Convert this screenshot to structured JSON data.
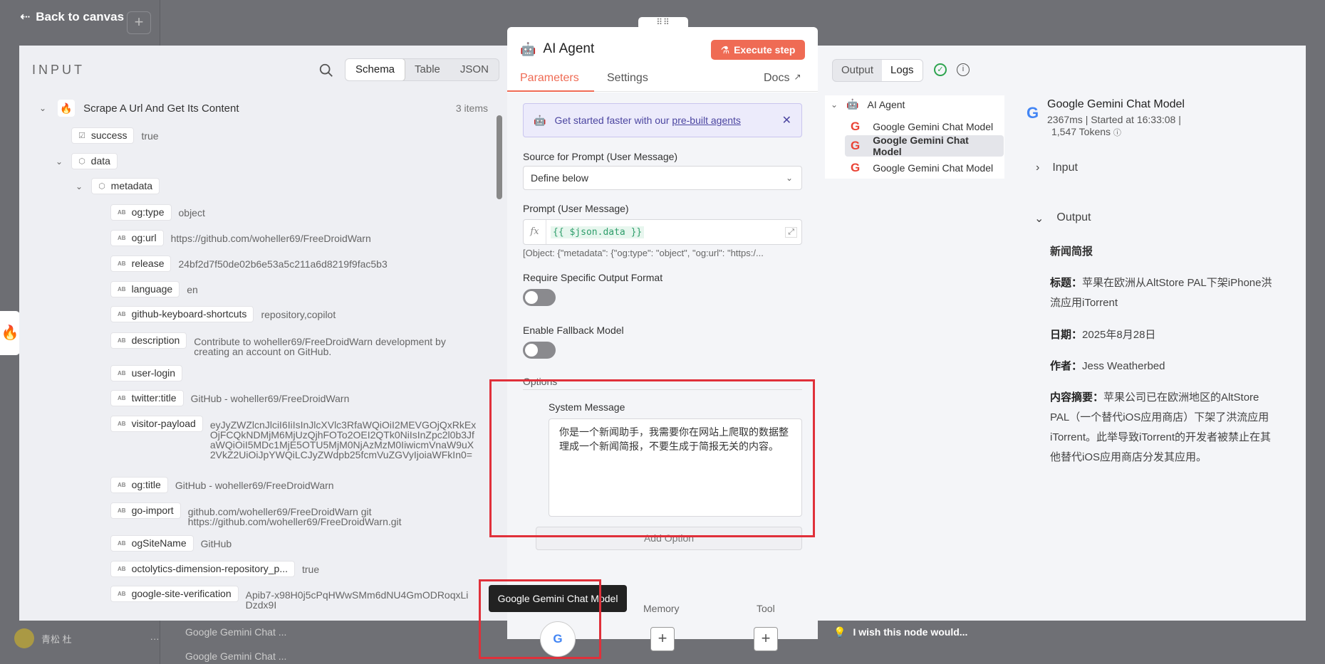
{
  "canvas": {
    "back_label": "Back to canvas",
    "user_name": "青松 杜",
    "bg_item1": "Google Gemini Chat ...",
    "bg_item2": "Google Gemini Chat ..."
  },
  "input": {
    "header": "INPUT",
    "tabs": [
      "Schema",
      "Table",
      "JSON"
    ],
    "active_tab": "Schema",
    "node_name": "Scrape A Url And Get Its Content",
    "items_count": "3 items",
    "fields": [
      {
        "key": "success",
        "value": "true"
      },
      {
        "key": "data",
        "value": ""
      },
      {
        "key": "metadata",
        "value": ""
      },
      {
        "key": "og:type",
        "value": "object"
      },
      {
        "key": "og:url",
        "value": "https://github.com/woheller69/FreeDroidWarn"
      },
      {
        "key": "release",
        "value": "24bf2d7f50de02b6e53a5c211a6d8219f9fac5b3"
      },
      {
        "key": "language",
        "value": "en"
      },
      {
        "key": "github-keyboard-shortcuts",
        "value": "repository,copilot"
      },
      {
        "key": "description",
        "value": "Contribute to woheller69/FreeDroidWarn development by creating an account on GitHub."
      },
      {
        "key": "user-login",
        "value": ""
      },
      {
        "key": "twitter:title",
        "value": "GitHub - woheller69/FreeDroidWarn"
      },
      {
        "key": "visitor-payload",
        "value": "eyJyZWZlcnJlciI6IiIsInJlcXVlc3RfaWQiOiI2MEVGOjQxRkExOjFCQkNDMjM6MjUzQjhFOTo2OEI2QTk0NiIsInZpc2l0b3JfaWQiOiI5MDc1MjE5OTU5MjM0NjAzMzM0IiwicmVnaW9uX2VkZ2UiOiJpYWQiLCJyZWdpb25fcmVuZGVyIjoiaWFkIn0="
      },
      {
        "key": "og:title",
        "value": "GitHub - woheller69/FreeDroidWarn"
      },
      {
        "key": "go-import",
        "value": "github.com/woheller69/FreeDroidWarn git https://github.com/woheller69/FreeDroidWarn.git"
      },
      {
        "key": "ogSiteName",
        "value": "GitHub"
      },
      {
        "key": "octolytics-dimension-repository_p...",
        "value": "true"
      },
      {
        "key": "google-site-verification",
        "value": "Apib7-x98H0j5cPqHWwSMm6dNU4GmODRoqxLiDzdx9I"
      }
    ]
  },
  "node": {
    "title": "AI Agent",
    "execute_label": "Execute step",
    "tabs": {
      "parameters": "Parameters",
      "settings": "Settings",
      "docs": "Docs"
    },
    "banner_prefix": "Get started faster with our ",
    "banner_link": "pre-built agents",
    "source_label": "Source for Prompt (User Message)",
    "source_value": "Define below",
    "prompt_label": "Prompt (User Message)",
    "prompt_expr": "{{ $json.data }}",
    "prompt_preview": "[Object: {\"metadata\": {\"og:type\": \"object\", \"og:url\": \"https:/...",
    "require_format_label": "Require Specific Output Format",
    "fallback_label": "Enable Fallback Model",
    "options_label": "Options",
    "system_message_label": "System Message",
    "system_message_value": "你是一个新闻助手，我需要你在网站上爬取的数据整理成一个新闻简报，不要生成于简报无关的内容。",
    "add_option_label": "Add Option",
    "tooltip": "Google Gemini Chat Model",
    "memory_label": "Memory",
    "tool_label": "Tool"
  },
  "output": {
    "tabs": [
      "Output",
      "Logs"
    ],
    "active_tab": "Logs",
    "tree": [
      {
        "label": "AI Agent",
        "icon": "robot"
      },
      {
        "label": "Google Gemini Chat Model",
        "icon": "google"
      },
      {
        "label": "Google Gemini Chat Model",
        "icon": "google",
        "selected": true
      },
      {
        "label": "Google Gemini Chat Model",
        "icon": "google"
      }
    ],
    "detail_title": "Google Gemini Chat Model",
    "detail_meta1": "2367ms | Started at 16:33:08 |",
    "detail_meta2": "1,547 Tokens",
    "input_section": "Input",
    "output_section": "Output",
    "news_title": "新闻简报",
    "headline_label": "标题：",
    "headline": "苹果在欧洲从AltStore PAL下架iPhone洪流应用iTorrent",
    "date_label": "日期：",
    "date": "2025年8月28日",
    "author_label": "作者：",
    "author": "Jess Weatherbed",
    "summary_label": "内容摘要：",
    "summary": "苹果公司已在欧洲地区的AltStore PAL（一个替代iOS应用商店）下架了洪流应用iTorrent。此举导致iTorrent的开发者被禁止在其他替代iOS应用商店分发其应用。",
    "footer": "I wish this node would..."
  },
  "colors": {
    "accent": "#ef6b54",
    "highlight": "#e0303a",
    "success": "#2ea44f"
  }
}
